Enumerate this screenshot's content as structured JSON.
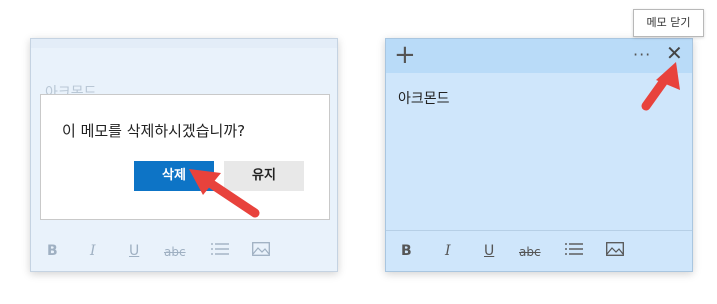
{
  "left_note": {
    "faded_text": "아크몬드",
    "dialog": {
      "message": "이 메모를 삭제하시겠습니까?",
      "delete_label": "삭제",
      "keep_label": "유지"
    },
    "toolbar": {
      "bold": "B",
      "italic": "I",
      "underline": "U",
      "strike": "abc"
    }
  },
  "right_note": {
    "header": {
      "add": "+",
      "more": "···",
      "close": "✕"
    },
    "body_text": "아크몬드",
    "toolbar": {
      "bold": "B",
      "italic": "I",
      "underline": "U",
      "strike": "abc"
    }
  },
  "tooltip": {
    "text": "메모 닫기"
  },
  "colors": {
    "delete_button": "#0d74c6",
    "note_header": "#b9dbf8",
    "note_body": "#cfe6fb",
    "annotation_arrow": "#e8423c"
  },
  "icons": [
    "add-icon",
    "more-icon",
    "close-icon",
    "list-icon",
    "image-icon"
  ]
}
